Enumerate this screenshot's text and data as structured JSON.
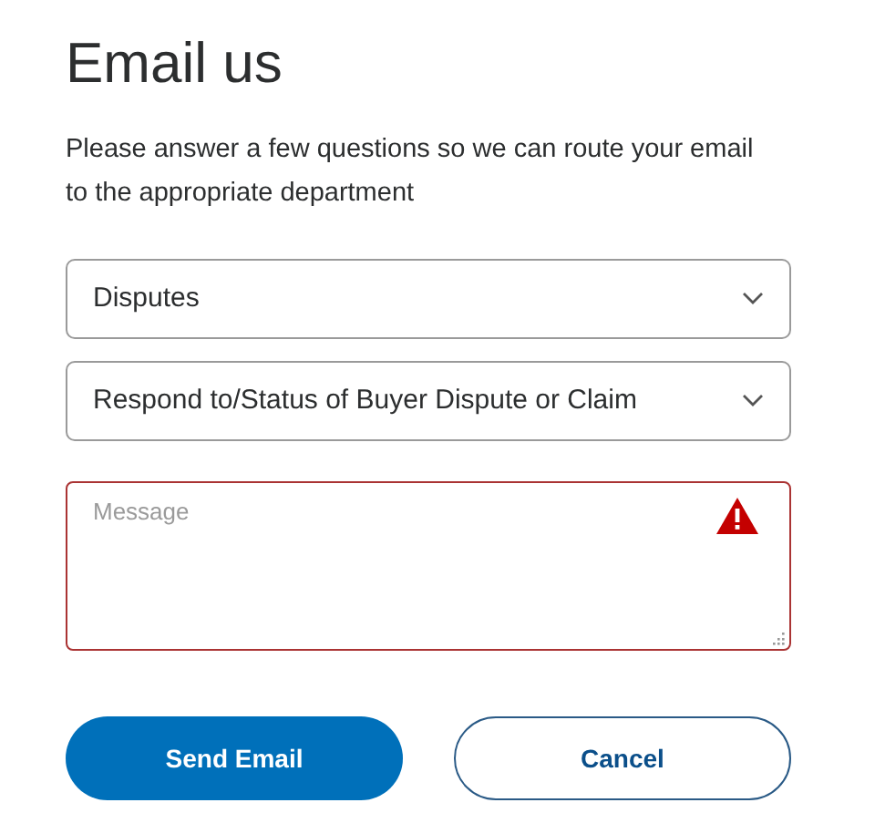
{
  "title": "Email us",
  "intro": "Please answer a few questions so we can route your email to the appropriate department",
  "selects": [
    {
      "value": "Disputes"
    },
    {
      "value": "Respond to/Status of Buyer Dispute or Claim"
    }
  ],
  "message": {
    "placeholder": "Message",
    "error": true
  },
  "buttons": [
    {
      "label": "Send Email",
      "kind": "primary"
    },
    {
      "label": "Cancel",
      "kind": "secondary"
    }
  ]
}
